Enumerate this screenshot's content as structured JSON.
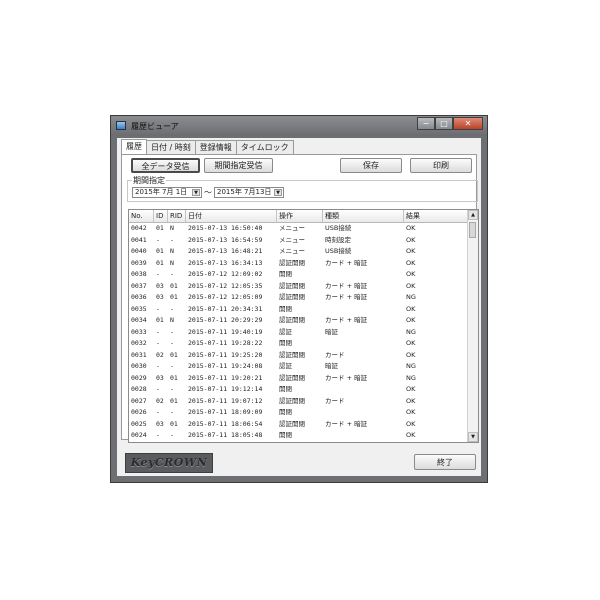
{
  "window": {
    "title": "履歴ビューア",
    "minimize_glyph": "−",
    "maximize_glyph": "□",
    "close_glyph": "✕"
  },
  "tabs": [
    {
      "label": "履歴",
      "active": true
    },
    {
      "label": "日付 / 時刻",
      "active": false
    },
    {
      "label": "登録情報",
      "active": false
    },
    {
      "label": "タイムロック",
      "active": false
    }
  ],
  "toolbar": {
    "receive_all": "全データ受信",
    "receive_period": "期間指定受信",
    "save": "保存",
    "print": "印刷"
  },
  "period": {
    "label": "期間指定",
    "from": "2015年 7月 1日",
    "to": "2015年 7月13日",
    "separator": "～"
  },
  "columns": [
    "No.",
    "ID",
    "RID",
    "日付",
    "操作",
    "種類",
    "結果"
  ],
  "rows": [
    {
      "no": "0042",
      "id": "01",
      "rid": "N",
      "date": "2015-07-13 16:50:40",
      "op": "メニュー",
      "type": "USB接続",
      "result": "OK"
    },
    {
      "no": "0041",
      "id": "-",
      "rid": "-",
      "date": "2015-07-13 16:54:59",
      "op": "メニュー",
      "type": "時刻設定",
      "result": "OK"
    },
    {
      "no": "0040",
      "id": "01",
      "rid": "N",
      "date": "2015-07-13 16:48:21",
      "op": "メニュー",
      "type": "USB接続",
      "result": "OK"
    },
    {
      "no": "0039",
      "id": "01",
      "rid": "N",
      "date": "2015-07-13 16:34:13",
      "op": "認証開閉",
      "type": "カード + 暗証",
      "result": "OK"
    },
    {
      "no": "0038",
      "id": "-",
      "rid": "-",
      "date": "2015-07-12 12:09:02",
      "op": "開閉",
      "type": "",
      "result": "OK"
    },
    {
      "no": "0037",
      "id": "03",
      "rid": "01",
      "date": "2015-07-12 12:05:35",
      "op": "認証開閉",
      "type": "カード + 暗証",
      "result": "OK"
    },
    {
      "no": "0036",
      "id": "03",
      "rid": "01",
      "date": "2015-07-12 12:05:09",
      "op": "認証開閉",
      "type": "カード + 暗証",
      "result": "NG"
    },
    {
      "no": "0035",
      "id": "-",
      "rid": "-",
      "date": "2015-07-11 20:34:31",
      "op": "開閉",
      "type": "",
      "result": "OK"
    },
    {
      "no": "0034",
      "id": "01",
      "rid": "N",
      "date": "2015-07-11 20:29:29",
      "op": "認証開閉",
      "type": "カード + 暗証",
      "result": "OK"
    },
    {
      "no": "0033",
      "id": "-",
      "rid": "-",
      "date": "2015-07-11 19:40:19",
      "op": "認証",
      "type": "暗証",
      "result": "NG"
    },
    {
      "no": "0032",
      "id": "-",
      "rid": "-",
      "date": "2015-07-11 19:28:22",
      "op": "開閉",
      "type": "",
      "result": "OK"
    },
    {
      "no": "0031",
      "id": "02",
      "rid": "01",
      "date": "2015-07-11 19:25:20",
      "op": "認証開閉",
      "type": "カード",
      "result": "OK"
    },
    {
      "no": "0030",
      "id": "-",
      "rid": "-",
      "date": "2015-07-11 19:24:08",
      "op": "認証",
      "type": "暗証",
      "result": "NG"
    },
    {
      "no": "0029",
      "id": "03",
      "rid": "01",
      "date": "2015-07-11 19:20:21",
      "op": "認証開閉",
      "type": "カード + 暗証",
      "result": "NG"
    },
    {
      "no": "0028",
      "id": "-",
      "rid": "-",
      "date": "2015-07-11 19:12:14",
      "op": "開閉",
      "type": "",
      "result": "OK"
    },
    {
      "no": "0027",
      "id": "02",
      "rid": "01",
      "date": "2015-07-11 19:07:12",
      "op": "認証開閉",
      "type": "カード",
      "result": "OK"
    },
    {
      "no": "0026",
      "id": "-",
      "rid": "-",
      "date": "2015-07-11 18:09:09",
      "op": "開閉",
      "type": "",
      "result": "OK"
    },
    {
      "no": "0025",
      "id": "03",
      "rid": "01",
      "date": "2015-07-11 18:06:54",
      "op": "認証開閉",
      "type": "カード + 暗証",
      "result": "OK"
    },
    {
      "no": "0024",
      "id": "-",
      "rid": "-",
      "date": "2015-07-11 18:05:48",
      "op": "開閉",
      "type": "",
      "result": "OK"
    }
  ],
  "footer": {
    "logo_text": "KeyCROWN",
    "exit": "終了"
  },
  "icons": {
    "dropdown": "▼",
    "scroll_up": "▲",
    "scroll_down": "▼"
  }
}
